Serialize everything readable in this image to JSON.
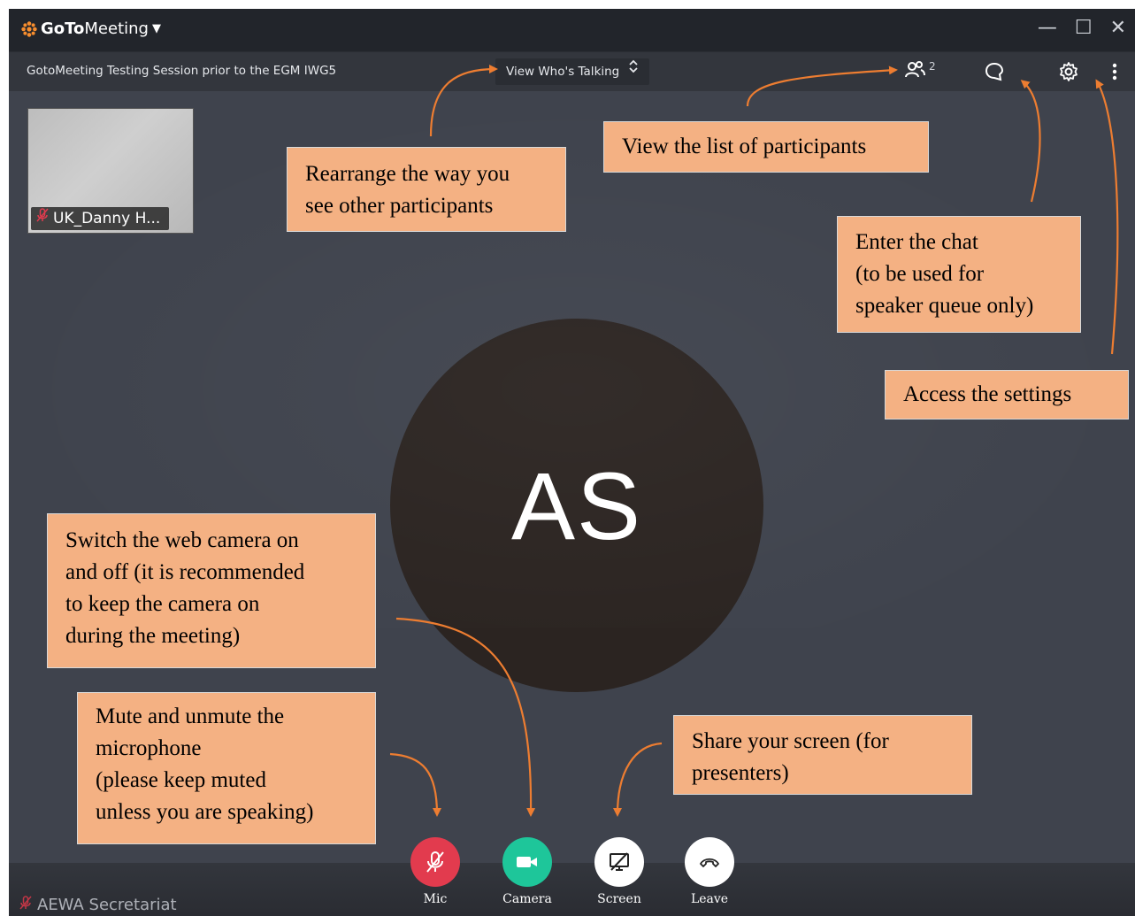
{
  "window": {
    "brand_goto": "GoTo",
    "brand_meeting": "Meeting",
    "brand_menu_icon": "caret-down-icon"
  },
  "toolbar": {
    "session_title": "GotoMeeting Testing Session prior to the EGM IWG5",
    "view_mode": "View Who's Talking",
    "participants_count": "2"
  },
  "self_tile": {
    "name": "UK_Danny H...",
    "mic_state": "muted"
  },
  "main_speaker": {
    "initials": "AS"
  },
  "controls": [
    {
      "label": "Mic",
      "icon": "mic-off-icon",
      "color": "#e23b4e"
    },
    {
      "label": "Camera",
      "icon": "camera-icon",
      "color": "#1ec69a"
    },
    {
      "label": "Screen",
      "icon": "screen-share-off-icon",
      "color": "#ffffff"
    },
    {
      "label": "Leave",
      "icon": "phone-hangup-icon",
      "color": "#ffffff"
    }
  ],
  "own_name": "AEWA Secretariat",
  "callouts": {
    "rearrange": "Rearrange the way you\nsee other participants",
    "participants": "View the list of participants",
    "chat": "Enter the chat\n(to be used for\nspeaker queue only)",
    "settings": "Access the settings",
    "camera": "Switch the web camera on\nand off (it is recommended\nto keep the camera on\nduring the meeting)",
    "mic": "Mute and unmute the\nmicrophone\n(please keep muted\nunless you are speaking)",
    "screen": "Share your screen (for\npresenters)"
  },
  "colors": {
    "callout_bg": "#f4b183",
    "arrow": "#ed7d31",
    "brand_star": "#f68d2e"
  }
}
